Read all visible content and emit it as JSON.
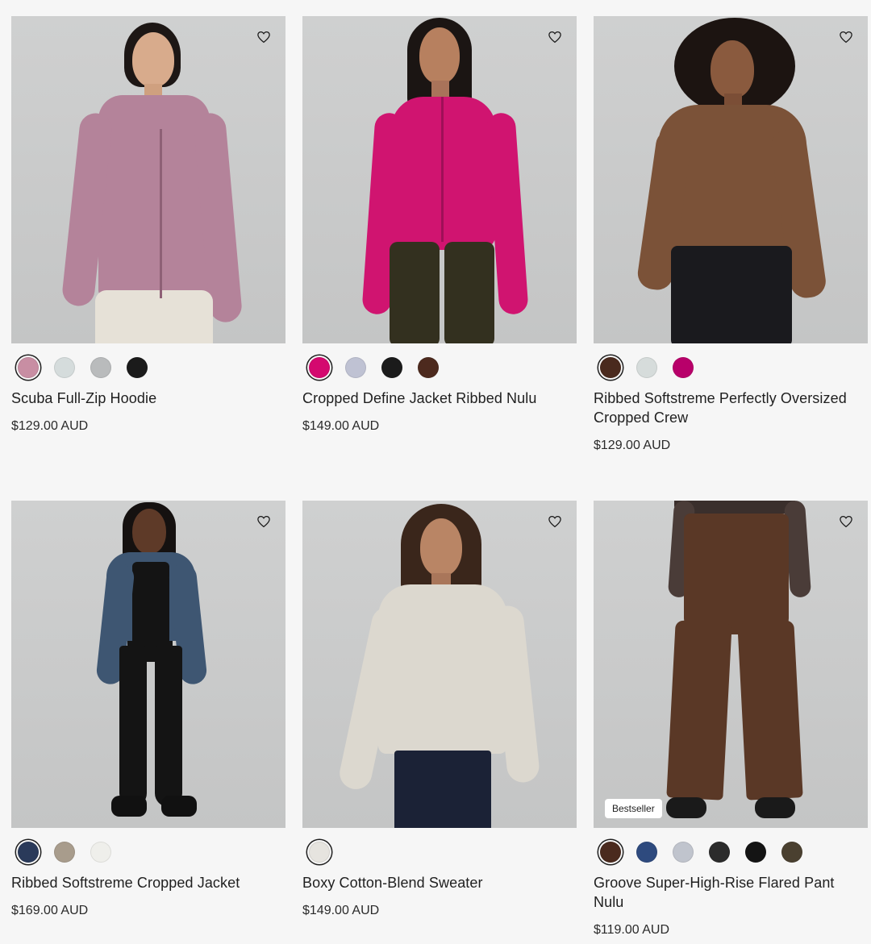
{
  "products": [
    {
      "name": "Scuba Full-Zip Hoodie",
      "price": "$129.00 AUD",
      "swatches": [
        "#c88ea3",
        "#d5dcdc",
        "#b9bbbc",
        "#1b1b1b"
      ],
      "image": {
        "garment": "#b4839a",
        "bottom": "#e6e1d7"
      },
      "badge": ""
    },
    {
      "name": "Cropped Define Jacket Ribbed Nulu",
      "price": "$149.00 AUD",
      "swatches": [
        "#d4096f",
        "#bfc2d3",
        "#1b1b1b",
        "#4d2a1e"
      ],
      "image": {
        "garment": "#d01470",
        "bottom": "#33301f"
      },
      "badge": ""
    },
    {
      "name": "Ribbed Softstreme Perfectly Oversized Cropped Crew",
      "price": "$129.00 AUD",
      "swatches": [
        "#4a2a1e",
        "#d6dcdb",
        "#b8006a"
      ],
      "image": {
        "garment": "#7b5238",
        "bottom": "#1a1a1e"
      },
      "badge": ""
    },
    {
      "name": "Ribbed Softstreme Cropped Jacket",
      "price": "$169.00 AUD",
      "swatches": [
        "#2a3a5a",
        "#a89c8c",
        "#efefeb"
      ],
      "image": {
        "garment": "#3e5672",
        "bottom": "#141414"
      },
      "badge": ""
    },
    {
      "name": "Boxy Cotton-Blend Sweater",
      "price": "$149.00 AUD",
      "swatches": [
        "#e6e4df"
      ],
      "image": {
        "garment": "#dcd8cf",
        "bottom": "#1b2236"
      },
      "badge": ""
    },
    {
      "name": "Groove Super-High-Rise Flared Pant Nulu",
      "price": "$119.00 AUD",
      "swatches": [
        "#4a2a1e",
        "#2e4a7e",
        "#c0c4cd",
        "#2b2b2b",
        "#141414",
        "#4a4030"
      ],
      "image": {
        "garment": "#5a3826",
        "bottom": "#5a3826"
      },
      "badge": "Bestseller"
    }
  ],
  "icons": {
    "favorite": "heart-outline-icon"
  }
}
